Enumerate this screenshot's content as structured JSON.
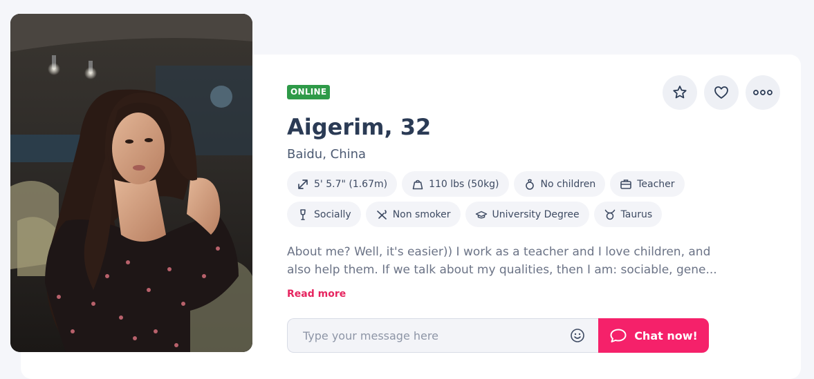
{
  "profile": {
    "status": "ONLINE",
    "name": "Aigerim, 32",
    "location": "Baidu, China",
    "photo_alt": "Profile photo"
  },
  "actions": {
    "favorite_icon": "star-icon",
    "like_icon": "heart-icon",
    "more_icon": "more-dots-icon"
  },
  "attributes": {
    "row1": [
      {
        "icon": "height-icon",
        "label": "5' 5.7\" (1.67m)"
      },
      {
        "icon": "weight-icon",
        "label": "110 lbs (50kg)"
      },
      {
        "icon": "children-icon",
        "label": "No children"
      },
      {
        "icon": "briefcase-icon",
        "label": "Teacher"
      }
    ],
    "row2": [
      {
        "icon": "drink-icon",
        "label": "Socially"
      },
      {
        "icon": "smoking-icon",
        "label": "Non smoker"
      },
      {
        "icon": "education-icon",
        "label": "University Degree"
      },
      {
        "icon": "zodiac-taurus-icon",
        "label": "Taurus"
      }
    ]
  },
  "about": {
    "line1": "About me? Well, it's easier)) I work as a teacher and I love children, and",
    "line2": "also help them. If we talk about my qualities, then I am: sociable, gene...",
    "read_more": "Read more"
  },
  "composer": {
    "placeholder": "Type your message here",
    "value": "",
    "chat_button": "Chat now!"
  },
  "colors": {
    "online": "#2e9a48",
    "accent": "#f5216a",
    "read_more": "#e6245f",
    "background": "#f5f6fa"
  }
}
